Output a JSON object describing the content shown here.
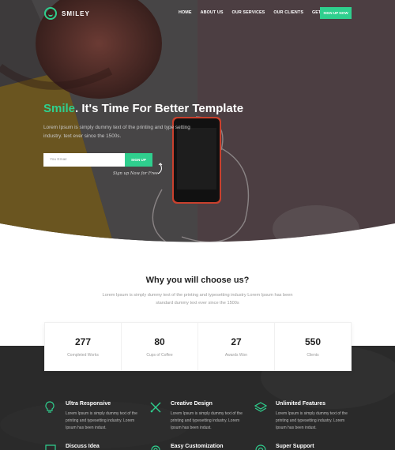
{
  "brand": {
    "name": "SMILEY"
  },
  "nav": {
    "items": [
      "HOME",
      "ABOUT US",
      "OUR SERVICES",
      "OUR CLIENTS",
      "GET IT NOW"
    ],
    "cta_label": "SIGN UP NOW"
  },
  "hero": {
    "title_accent": "Smile",
    "title_rest": ". It's Time For Better Template",
    "description": "Lorem Ipsum is simply dummy text of the printing and type setting industry. text ever since the 1500s.",
    "email_placeholder": "You Email",
    "signup_label": "SIGN UP",
    "signup_note": "Sign up Now for Free"
  },
  "why": {
    "title": "Why you will choose us?",
    "description": "Lorem Ipsum is simply dummy text of the printing and typesetting industry Lorem Ipsum has been standard dummy text ever since the 1500s"
  },
  "stats": [
    {
      "value": "277",
      "label": "Completed Works"
    },
    {
      "value": "80",
      "label": "Cups of Coffee"
    },
    {
      "value": "27",
      "label": "Awards Won"
    },
    {
      "value": "550",
      "label": "Clients"
    }
  ],
  "features": [
    {
      "title": "Ultra Responsive",
      "icon": "lightbulb-icon",
      "description": "Lorem Ipsum is simply dummy text of the printing and typesetting industry. Lorem Ipsum has been indust."
    },
    {
      "title": "Creative Design",
      "icon": "pencil-ruler-icon",
      "description": "Lorem Ipsum is simply dummy text of the printing and typesetting industry. Lorem Ipsum has been indust."
    },
    {
      "title": "Unlimited Features",
      "icon": "layers-icon",
      "description": "Lorem Ipsum is simply dummy text of the printing and typesetting industry. Lorem Ipsum has been indust."
    },
    {
      "title": "Discuss Idea",
      "icon": "chat-icon",
      "description": ""
    },
    {
      "title": "Easy Customization",
      "icon": "settings-icon",
      "description": ""
    },
    {
      "title": "Super Support",
      "icon": "support-icon",
      "description": ""
    }
  ],
  "colors": {
    "accent": "#2fcf8e",
    "dark": "#2b2b2b",
    "hero_overlay": "#4a3d40"
  }
}
